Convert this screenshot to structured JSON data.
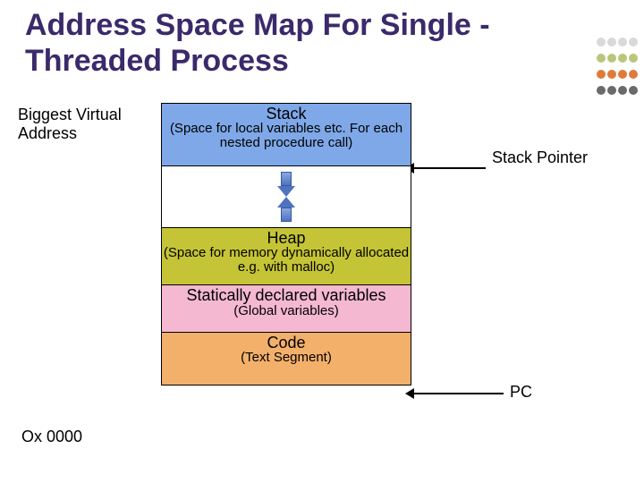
{
  "title": "Address Space Map For Single -Threaded Process",
  "labels": {
    "biggest": "Biggest Virtual Address",
    "zero": "Ox 0000",
    "stack_pointer": "Stack Pointer",
    "pc": "PC"
  },
  "segments": {
    "stack": {
      "title": "Stack",
      "sub": "(Space for local variables etc. For each nested procedure call)"
    },
    "heap": {
      "title": "Heap",
      "sub": "(Space for memory dynamically allocated e.g. with malloc)"
    },
    "static": {
      "title": "Statically declared variables",
      "sub": "(Global variables)"
    },
    "code": {
      "title": "Code",
      "sub": "(Text Segment)"
    }
  },
  "colors": {
    "stack": "#7fa8e8",
    "heap": "#c5c436",
    "static": "#f4b8d0",
    "code": "#f3b06a",
    "title": "#3b2a6b",
    "dot_row1": "#d9d9d9",
    "dot_row2": "#b8c77a",
    "dot_row3": "#e07a3a",
    "dot_row4": "#6a6a6a"
  }
}
